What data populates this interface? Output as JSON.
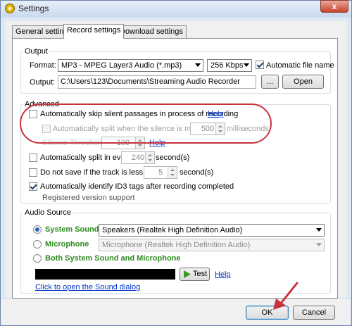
{
  "window": {
    "title": "Settings",
    "close_glyph": "x"
  },
  "tabs": [
    {
      "label": "General settings"
    },
    {
      "label": "Record settings"
    },
    {
      "label": "Download settings"
    }
  ],
  "output": {
    "group_label": "Output",
    "format_label": "Format:",
    "format_value": "MP3 - MPEG Layer3 Audio (*.mp3)",
    "bitrate_value": "256 Kbps",
    "auto_file_name_label": "Automatic file name",
    "output_label": "Output:",
    "output_path": "C:\\Users\\123\\Documents\\Streaming Audio Recorder",
    "browse_label": "...",
    "open_label": "Open"
  },
  "advanced": {
    "group_label": "Advanced",
    "skip_silent_label": "Automatically skip silent passages in process of recording",
    "help_label": "Help",
    "auto_split_silence_label": "Automatically split when the silence is more than",
    "split_silence_value": "500",
    "milliseconds_label": "milliseconds",
    "silence_threshold_label": "Silence Threshold:",
    "silence_threshold_value": "100",
    "split_every_label": "Automatically split in every",
    "split_every_value": "240",
    "seconds_label": "second(s)",
    "no_save_label": "Do not save if the track is less than",
    "no_save_value": "5",
    "id3_label": "Automatically identify ID3 tags after recording completed",
    "registered_label": "Registered version support"
  },
  "audio_source": {
    "group_label": "Audio Source",
    "system_sound_label": "System Sound",
    "system_sound_device": "Speakers (Realtek High Definition Audio)",
    "microphone_label": "Microphone",
    "microphone_device": "Microphone (Realtek High Definition Audio)",
    "both_label": "Both System Sound and Microphone",
    "test_label": "Test",
    "help_label": "Help",
    "sound_dialog_link": "Click to open the Sound dialog"
  },
  "footer": {
    "ok_label": "OK",
    "cancel_label": "Cancel"
  },
  "colors": {
    "accent_green": "#2d8a1f",
    "link_blue": "#0033cc",
    "annotation_red": "#c8323c"
  }
}
